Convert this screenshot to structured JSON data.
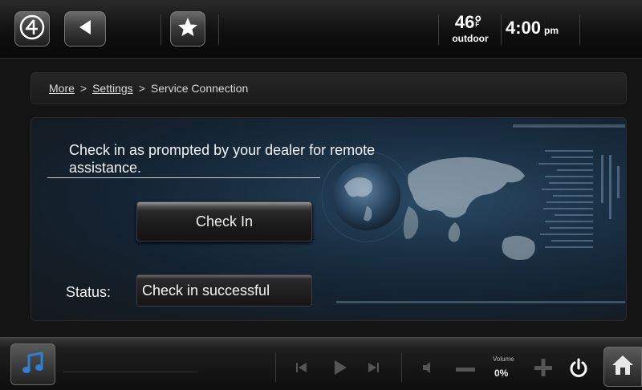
{
  "header": {
    "temperature": "46°",
    "temperature_unit": "F",
    "weather_label": "outdoor",
    "time": "4:00",
    "ampm": "pm"
  },
  "breadcrumb": {
    "items": [
      "More",
      "Settings",
      "Service Connection"
    ],
    "separator": ">"
  },
  "main": {
    "message": "Check in as prompted by your dealer for remote assistance.",
    "check_in_label": "Check In",
    "status_label": "Status:",
    "status_value": "Check in successful"
  },
  "footer": {
    "volume_label": "Volume",
    "volume_value": "0%"
  },
  "icons": {
    "brand": "control4-logo-icon",
    "back": "back-arrow-icon",
    "favorite": "star-icon",
    "music": "music-note-icon",
    "prev": "skip-previous-icon",
    "play": "play-icon",
    "next": "skip-next-icon",
    "mute": "speaker-icon",
    "vol_down": "minus-icon",
    "vol_up": "plus-icon",
    "power": "power-icon",
    "home": "home-icon"
  },
  "colors": {
    "accent_blue": "#2f7fd6",
    "panel_bg": "#142433"
  }
}
